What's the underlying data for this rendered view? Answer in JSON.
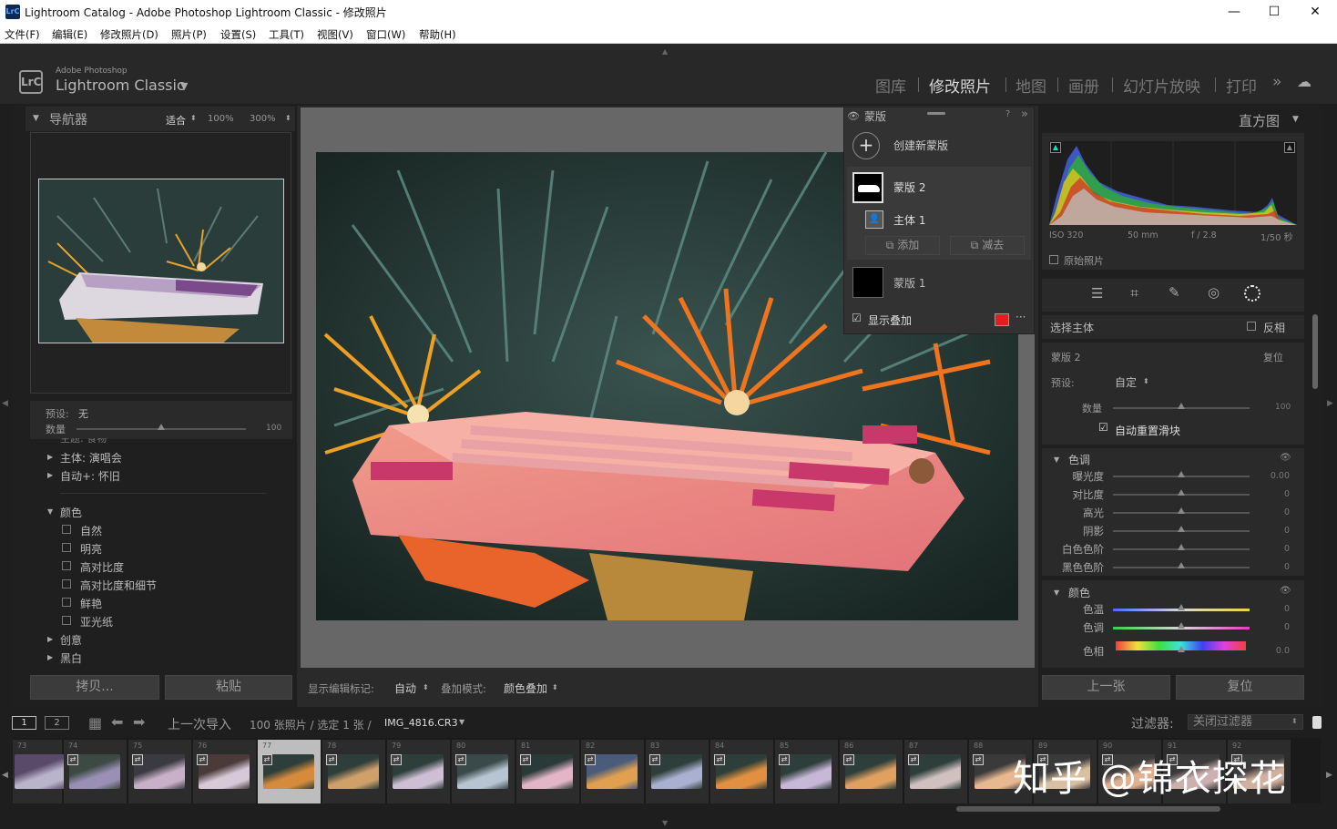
{
  "window": {
    "title": "Lightroom Catalog - Adobe Photoshop Lightroom Classic - 修改照片",
    "logo": "LrC",
    "min": "—",
    "max": "☐",
    "close": "✕"
  },
  "menu": [
    "文件(F)",
    "编辑(E)",
    "修改照片(D)",
    "照片(P)",
    "设置(S)",
    "工具(T)",
    "视图(V)",
    "窗口(W)",
    "帮助(H)"
  ],
  "brand": {
    "badge": "LrC",
    "top": "Adobe Photoshop",
    "name": "Lightroom Classic"
  },
  "modules": [
    "图库",
    "修改照片",
    "地图",
    "画册",
    "幻灯片放映",
    "打印"
  ],
  "navigator": {
    "title": "导航器",
    "fit": "适合",
    "z1": "100%",
    "z2": "300%"
  },
  "preset": {
    "label": "预设:",
    "value": "无",
    "amount": "数量",
    "amount_value": "100"
  },
  "presets": {
    "clipped": "主题: 食物",
    "items": [
      "主体: 演唱会",
      "自动+: 怀旧"
    ],
    "color_group": "颜色",
    "color_items": [
      "自然",
      "明亮",
      "高对比度",
      "高对比度和细节",
      "鲜艳",
      "亚光纸"
    ],
    "more": [
      "创意",
      "黑白"
    ]
  },
  "left_buttons": {
    "copy": "拷贝...",
    "paste": "粘贴"
  },
  "masks": {
    "title": "蒙版",
    "create": "创建新蒙版",
    "mask2": "蒙版 2",
    "subject": "主体 1",
    "add": "添加",
    "subtract": "减去",
    "mask1": "蒙版 1",
    "overlay": "显示叠加"
  },
  "toolbar": {
    "label": "显示编辑标记:",
    "value": "自动",
    "mode_label": "叠加模式:",
    "mode_value": "颜色叠加"
  },
  "histogram": {
    "title": "直方图",
    "iso": "ISO 320",
    "focal": "50 mm",
    "aperture": "f / 2.8",
    "shutter": "1/50 秒",
    "original": "原始照片"
  },
  "right": {
    "select_subject": "选择主体",
    "invert": "反相",
    "mask_name": "蒙版 2",
    "reset": "复位",
    "preset_label": "预设:",
    "preset_value": "自定",
    "amount": "数量",
    "amount_value": "100",
    "auto_reset": "自动重置滑块",
    "tone": "色调",
    "color": "颜色",
    "tone_sliders": [
      {
        "label": "曝光度",
        "value": "0.00"
      },
      {
        "label": "对比度",
        "value": "0"
      },
      {
        "label": "高光",
        "value": "0"
      },
      {
        "label": "阴影",
        "value": "0"
      },
      {
        "label": "白色色阶",
        "value": "0"
      },
      {
        "label": "黑色色阶",
        "value": "0"
      }
    ],
    "color_sliders": [
      {
        "label": "色温",
        "value": "0"
      },
      {
        "label": "色调",
        "value": "0"
      },
      {
        "label": "色相",
        "value": "0.0"
      }
    ],
    "prev": "上一张",
    "reset_btn": "复位"
  },
  "filmbar": {
    "v1": "1",
    "v2": "2",
    "source": "上一次导入",
    "count": "100 张照片 / 选定 1 张 /",
    "file": "IMG_4816.CR3",
    "filter_label": "过滤器:",
    "filter_value": "关闭过滤器"
  },
  "filmstrip": [
    "73",
    "74",
    "75",
    "76",
    "77",
    "78",
    "79",
    "80",
    "81",
    "82",
    "83",
    "84",
    "85",
    "86",
    "87",
    "88",
    "89",
    "90",
    "91",
    "92"
  ],
  "watermark": "知乎 @锦衣探花",
  "colors": {
    "overlay": "#e0201e",
    "accent": "#d8d8d8"
  }
}
